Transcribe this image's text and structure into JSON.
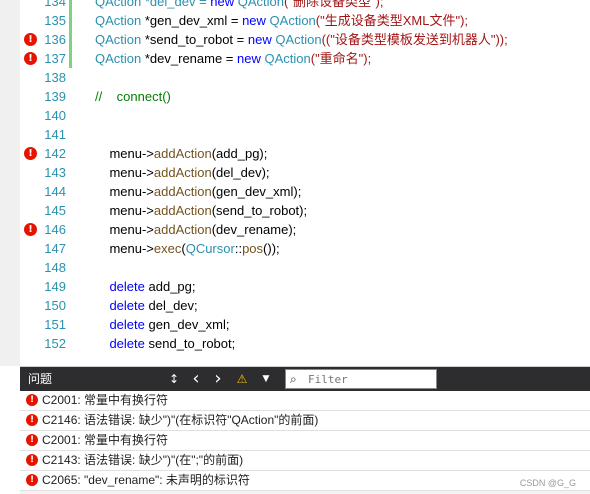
{
  "editor": {
    "lines": [
      {
        "num": "134",
        "err": false,
        "changed": true,
        "code": [
          {
            "t": "QAction *del_dev = ",
            "c": "t"
          },
          {
            "t": "new ",
            "c": "k"
          },
          {
            "t": "QAction",
            "c": "t"
          },
          {
            "t": "(\"删除设备类型\");",
            "c": "s"
          }
        ]
      },
      {
        "num": "135",
        "err": false,
        "changed": true,
        "code": [
          {
            "t": "QAction ",
            "c": "t"
          },
          {
            "t": "*gen_dev_xml = ",
            "c": ""
          },
          {
            "t": "new ",
            "c": "k"
          },
          {
            "t": "QAction",
            "c": "t"
          },
          {
            "t": "(\"生成设备类型XML文件\");",
            "c": "s"
          }
        ]
      },
      {
        "num": "136",
        "err": true,
        "changed": true,
        "code": [
          {
            "t": "QAction ",
            "c": "t"
          },
          {
            "t": "*send_to_robot = ",
            "c": ""
          },
          {
            "t": "new ",
            "c": "k"
          },
          {
            "t": "QAction",
            "c": "t"
          },
          {
            "t": "((\"设备类型模板发送到机器人\"));",
            "c": "s"
          }
        ]
      },
      {
        "num": "137",
        "err": true,
        "changed": true,
        "code": [
          {
            "t": "QAction ",
            "c": "t"
          },
          {
            "t": "*dev_rename = ",
            "c": ""
          },
          {
            "t": "new ",
            "c": "k"
          },
          {
            "t": "QAction",
            "c": "t"
          },
          {
            "t": "(\"重命名\");",
            "c": "s"
          }
        ]
      },
      {
        "num": "138",
        "err": false,
        "changed": false,
        "code": []
      },
      {
        "num": "139",
        "err": false,
        "changed": false,
        "code": [
          {
            "t": "//    connect()",
            "c": "c"
          }
        ]
      },
      {
        "num": "140",
        "err": false,
        "changed": false,
        "code": []
      },
      {
        "num": "141",
        "err": false,
        "changed": false,
        "code": []
      },
      {
        "num": "142",
        "err": true,
        "changed": false,
        "code": [
          {
            "t": "    menu->",
            "c": ""
          },
          {
            "t": "addAction",
            "c": "f"
          },
          {
            "t": "(add_pg);",
            "c": ""
          }
        ]
      },
      {
        "num": "143",
        "err": false,
        "changed": false,
        "code": [
          {
            "t": "    menu->",
            "c": ""
          },
          {
            "t": "addAction",
            "c": "f"
          },
          {
            "t": "(del_dev);",
            "c": ""
          }
        ]
      },
      {
        "num": "144",
        "err": false,
        "changed": false,
        "code": [
          {
            "t": "    menu->",
            "c": ""
          },
          {
            "t": "addAction",
            "c": "f"
          },
          {
            "t": "(gen_dev_xml);",
            "c": ""
          }
        ]
      },
      {
        "num": "145",
        "err": false,
        "changed": false,
        "code": [
          {
            "t": "    menu->",
            "c": ""
          },
          {
            "t": "addAction",
            "c": "f"
          },
          {
            "t": "(send_to_robot);",
            "c": ""
          }
        ]
      },
      {
        "num": "146",
        "err": true,
        "changed": false,
        "code": [
          {
            "t": "    menu->",
            "c": ""
          },
          {
            "t": "addAction",
            "c": "f"
          },
          {
            "t": "(dev_rename);",
            "c": ""
          }
        ]
      },
      {
        "num": "147",
        "err": false,
        "changed": false,
        "code": [
          {
            "t": "    menu->",
            "c": ""
          },
          {
            "t": "exec",
            "c": "f"
          },
          {
            "t": "(",
            "c": ""
          },
          {
            "t": "QCursor",
            "c": "t"
          },
          {
            "t": "::",
            "c": ""
          },
          {
            "t": "pos",
            "c": "f"
          },
          {
            "t": "());",
            "c": ""
          }
        ]
      },
      {
        "num": "148",
        "err": false,
        "changed": false,
        "code": []
      },
      {
        "num": "149",
        "err": false,
        "changed": false,
        "code": [
          {
            "t": "    ",
            "c": ""
          },
          {
            "t": "delete ",
            "c": "k"
          },
          {
            "t": "add_pg;",
            "c": ""
          }
        ]
      },
      {
        "num": "150",
        "err": false,
        "changed": false,
        "code": [
          {
            "t": "    ",
            "c": ""
          },
          {
            "t": "delete ",
            "c": "k"
          },
          {
            "t": "del_dev;",
            "c": ""
          }
        ]
      },
      {
        "num": "151",
        "err": false,
        "changed": false,
        "code": [
          {
            "t": "    ",
            "c": ""
          },
          {
            "t": "delete ",
            "c": "k"
          },
          {
            "t": "gen_dev_xml;",
            "c": ""
          }
        ]
      },
      {
        "num": "152",
        "err": false,
        "changed": false,
        "code": [
          {
            "t": "    ",
            "c": ""
          },
          {
            "t": "delete ",
            "c": "k"
          },
          {
            "t": "send_to_robot;",
            "c": ""
          }
        ]
      }
    ]
  },
  "panel": {
    "title": "问题",
    "icons": {
      "filter_list": "filter-list-icon",
      "prev": "chevron-left-icon",
      "next": "chevron-right-icon",
      "warning": "warning-icon",
      "filter": "filter-icon",
      "search": "search-icon"
    },
    "toolbar_glyphs": {
      "filter_list": "↕",
      "prev": "‹",
      "next": "›",
      "warning": "⚠",
      "filter": "▼",
      "search": "⌕",
      "error": "!"
    },
    "search_placeholder": "Filter",
    "errors": [
      "C2001: 常量中有换行符",
      "C2146: 语法错误: 缺少\")\"(在标识符\"QAction\"的前面)",
      "C2001: 常量中有换行符",
      "C2143: 语法错误: 缺少\")\"(在\";\"的前面)",
      "C2065: \"dev_rename\": 未声明的标识符"
    ],
    "watermark": "CSDN @G_G"
  },
  "colors": {
    "error": "#e51400",
    "toolbar_bg": "#2d2d30",
    "line_number": "#2b91af",
    "keyword": "#0000ff",
    "type": "#2b91af",
    "string": "#a31515",
    "comment": "#008000",
    "change_bar": "#7fd27f"
  }
}
